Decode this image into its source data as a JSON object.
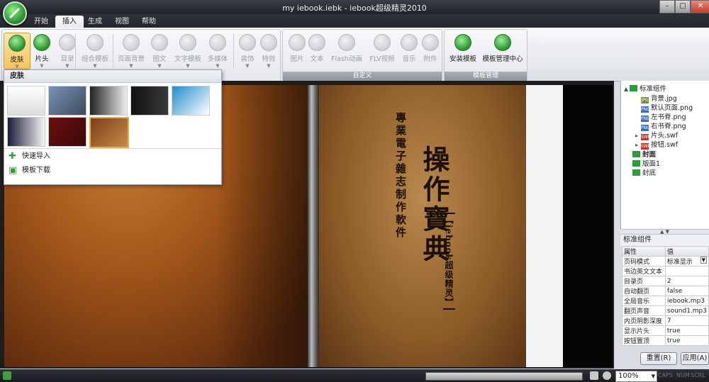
{
  "window": {
    "title": "my iebook.iebk - iebook超级精灵2010",
    "controls": [
      "–",
      "□",
      "✕"
    ]
  },
  "menu_tabs": [
    "开始",
    "插入",
    "生成",
    "视图",
    "帮助"
  ],
  "active_tab": "插入",
  "ribbon": {
    "group1_buttons": [
      "皮肤",
      "片头",
      "目录",
      "组合模板",
      "页面背景",
      "图文",
      "文字模板",
      "多媒体",
      "装饰",
      "特效"
    ],
    "group2_buttons": [
      "图片",
      "文本",
      "Flash动画",
      "FLV视频",
      "音乐",
      "附件"
    ],
    "group2_label": "自定义",
    "group3_buttons": [
      "安装模板",
      "模板管理中心"
    ],
    "group3_label": "模板管理"
  },
  "skin_panel": {
    "header": "皮肤",
    "quick_import": "快速导入",
    "template_download": "模板下载"
  },
  "book": {
    "subtitle": "專業電子雜志制作軟件",
    "title": "操作寶典",
    "brand": "【iebook超级精灵】"
  },
  "tree": {
    "root": "标准组件",
    "children": [
      "背景.jpg",
      "默认页面.png",
      "左书脊.png",
      "右书脊.png",
      "片头.swf",
      "按钮.swf"
    ],
    "sections": [
      "封面",
      "版面1",
      "封底"
    ]
  },
  "properties": {
    "title": "标准组件",
    "header_key": "属性",
    "header_value": "值",
    "rows": [
      {
        "key": "页码模式",
        "value": "标准显示"
      },
      {
        "key": "书边英文文本",
        "value": ""
      },
      {
        "key": "目录页",
        "value": "2"
      },
      {
        "key": "自动翻页",
        "value": "false"
      },
      {
        "key": "全局音乐",
        "value": "iebook.mp3"
      },
      {
        "key": "翻页声音",
        "value": "sound1.mp3"
      },
      {
        "key": "内页阴影深度",
        "value": "7"
      },
      {
        "key": "显示片头",
        "value": "true"
      },
      {
        "key": "按钮置顶",
        "value": "true"
      }
    ],
    "reset_button": "重置(R)",
    "apply_button": "应用(A)"
  },
  "status": {
    "zoom": "100%",
    "keys": [
      "CAPS",
      "NUM",
      "SCRL"
    ]
  }
}
